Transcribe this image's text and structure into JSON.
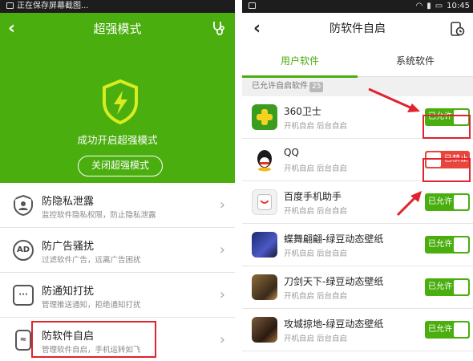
{
  "left": {
    "status_text": "正在保存屏幕截图...",
    "title": "超强模式",
    "hero_message": "成功开启超强模式",
    "close_button": "关闭超强模式",
    "menu": [
      {
        "title": "防隐私泄露",
        "subtitle": "监控软件隐私权限，防止隐私泄露",
        "icon": "user-shield-icon",
        "icon_text": ""
      },
      {
        "title": "防广告骚扰",
        "subtitle": "过滤软件广告，远离广告困扰",
        "icon": "ad-block-icon",
        "icon_text": "AD"
      },
      {
        "title": "防通知打扰",
        "subtitle": "管理推送通知，拒绝通知打扰",
        "icon": "notification-icon",
        "icon_text": "···"
      },
      {
        "title": "防软件自启",
        "subtitle": "管理软件自启，手机运转如飞",
        "icon": "autostart-icon",
        "icon_text": "≈"
      }
    ]
  },
  "right": {
    "status_time": "10:45",
    "title": "防软件自启",
    "tabs": [
      "用户软件",
      "系统软件"
    ],
    "section_label": "已允许自启软件",
    "section_count": "25",
    "apps": [
      {
        "name": "360卫士",
        "sub": "开机自启 后台自启",
        "state": "on",
        "toggle_label": "已允许",
        "icon_color": "#3a9d1f"
      },
      {
        "name": "QQ",
        "sub": "开机自启 后台自启",
        "state": "off",
        "toggle_label": "已禁止",
        "icon_color": "#1a1a1a"
      },
      {
        "name": "百度手机助手",
        "sub": "开机自启 后台自启",
        "state": "on",
        "toggle_label": "已允许",
        "icon_color": "#f2f2f2"
      },
      {
        "name": "蝶舞翩翩-绿豆动态壁纸",
        "sub": "开机自启 后台自启",
        "state": "on",
        "toggle_label": "已允许",
        "icon_color": "#3b3f8f"
      },
      {
        "name": "刀剑天下-绿豆动态壁纸",
        "sub": "开机自启 后台自启",
        "state": "on",
        "toggle_label": "已允许",
        "icon_color": "#6a4a2a"
      },
      {
        "name": "攻城掠地-绿豆动态壁纸",
        "sub": "开机自启 后台自启",
        "state": "on",
        "toggle_label": "已允许",
        "icon_color": "#5a4030"
      }
    ]
  },
  "colors": {
    "accent": "#4aae0f",
    "highlight": "#e0232e",
    "deny": "#e8453c"
  }
}
